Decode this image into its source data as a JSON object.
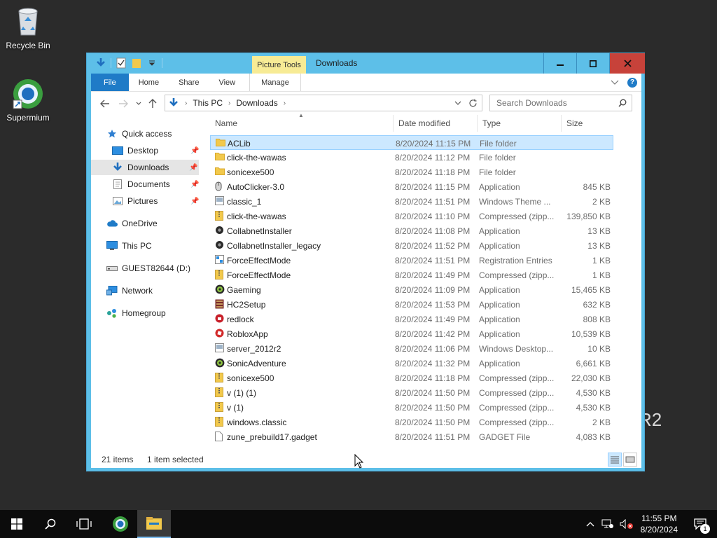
{
  "desktop": {
    "icons": [
      {
        "label": "Recycle Bin"
      },
      {
        "label": "Supermium"
      }
    ],
    "watermark_fragment": "R2"
  },
  "window": {
    "title": "Downloads",
    "contextual_tab_group": "Picture Tools",
    "ribbon_tabs": [
      "File",
      "Home",
      "Share",
      "View",
      "Manage"
    ],
    "address": {
      "crumbs": [
        "This PC",
        "Downloads"
      ]
    },
    "search_placeholder": "Search Downloads",
    "nav_pane": {
      "quick_access": "Quick access",
      "quick_items": [
        {
          "label": "Desktop",
          "pinned": true
        },
        {
          "label": "Downloads",
          "pinned": true,
          "selected": true
        },
        {
          "label": "Documents",
          "pinned": true
        },
        {
          "label": "Pictures",
          "pinned": true
        }
      ],
      "onedrive": "OneDrive",
      "this_pc": "This PC",
      "drive": "GUEST82644 (D:)",
      "network": "Network",
      "homegroup": "Homegroup"
    },
    "columns": [
      "Name",
      "Date modified",
      "Type",
      "Size"
    ],
    "files": [
      {
        "name": "ACLib",
        "date": "8/20/2024 11:15 PM",
        "type": "File folder",
        "size": "",
        "icon": "folder",
        "selected": true
      },
      {
        "name": "click-the-wawas",
        "date": "8/20/2024 11:12 PM",
        "type": "File folder",
        "size": "",
        "icon": "folder"
      },
      {
        "name": "sonicexe500",
        "date": "8/20/2024 11:18 PM",
        "type": "File folder",
        "size": "",
        "icon": "folder"
      },
      {
        "name": "AutoClicker-3.0",
        "date": "8/20/2024 11:15 PM",
        "type": "Application",
        "size": "845 KB",
        "icon": "mouse"
      },
      {
        "name": "classic_1",
        "date": "8/20/2024 11:51 PM",
        "type": "Windows Theme ...",
        "size": "2 KB",
        "icon": "theme"
      },
      {
        "name": "click-the-wawas",
        "date": "8/20/2024 11:10 PM",
        "type": "Compressed (zipp...",
        "size": "139,850 KB",
        "icon": "zip"
      },
      {
        "name": "CollabnetInstaller",
        "date": "8/20/2024 11:08 PM",
        "type": "Application",
        "size": "13 KB",
        "icon": "app-dark"
      },
      {
        "name": "CollabnetInstaller_legacy",
        "date": "8/20/2024 11:52 PM",
        "type": "Application",
        "size": "13 KB",
        "icon": "app-dark"
      },
      {
        "name": "ForceEffectMode",
        "date": "8/20/2024 11:51 PM",
        "type": "Registration Entries",
        "size": "1 KB",
        "icon": "reg"
      },
      {
        "name": "ForceEffectMode",
        "date": "8/20/2024 11:49 PM",
        "type": "Compressed (zipp...",
        "size": "1 KB",
        "icon": "zip"
      },
      {
        "name": "Gaeming",
        "date": "8/20/2024 11:09 PM",
        "type": "Application",
        "size": "15,465 KB",
        "icon": "gear-green"
      },
      {
        "name": "HC2Setup",
        "date": "8/20/2024 11:53 PM",
        "type": "Application",
        "size": "632 KB",
        "icon": "setup"
      },
      {
        "name": "redlock",
        "date": "8/20/2024 11:49 PM",
        "type": "Application",
        "size": "808 KB",
        "icon": "redlock"
      },
      {
        "name": "RobloxApp",
        "date": "8/20/2024 11:42 PM",
        "type": "Application",
        "size": "10,539 KB",
        "icon": "roblox"
      },
      {
        "name": "server_2012r2",
        "date": "8/20/2024 11:06 PM",
        "type": "Windows Desktop...",
        "size": "10 KB",
        "icon": "theme"
      },
      {
        "name": "SonicAdventure",
        "date": "8/20/2024 11:32 PM",
        "type": "Application",
        "size": "6,661 KB",
        "icon": "gear-green"
      },
      {
        "name": "sonicexe500",
        "date": "8/20/2024 11:18 PM",
        "type": "Compressed (zipp...",
        "size": "22,030 KB",
        "icon": "zip"
      },
      {
        "name": "v (1) (1)",
        "date": "8/20/2024 11:50 PM",
        "type": "Compressed (zipp...",
        "size": "4,530 KB",
        "icon": "zip"
      },
      {
        "name": "v (1)",
        "date": "8/20/2024 11:50 PM",
        "type": "Compressed (zipp...",
        "size": "4,530 KB",
        "icon": "zip"
      },
      {
        "name": "windows.classic",
        "date": "8/20/2024 11:50 PM",
        "type": "Compressed (zipp...",
        "size": "2 KB",
        "icon": "zip"
      },
      {
        "name": "zune_prebuild17.gadget",
        "date": "8/20/2024 11:51 PM",
        "type": "GADGET File",
        "size": "4,083 KB",
        "icon": "file"
      }
    ],
    "status": {
      "items": "21 items",
      "selected": "1 item selected"
    }
  },
  "taskbar": {
    "time": "11:55 PM",
    "date": "8/20/2024",
    "notification_count": "1"
  },
  "colors": {
    "window_frame": "#5dbfe8",
    "close_button": "#c7423a",
    "file_tab": "#1f7bc7",
    "contextual_tab": "#f7eb95",
    "selection": "#cce8ff",
    "folder": "#f2c94c",
    "taskbar": "#0c0c0c"
  }
}
